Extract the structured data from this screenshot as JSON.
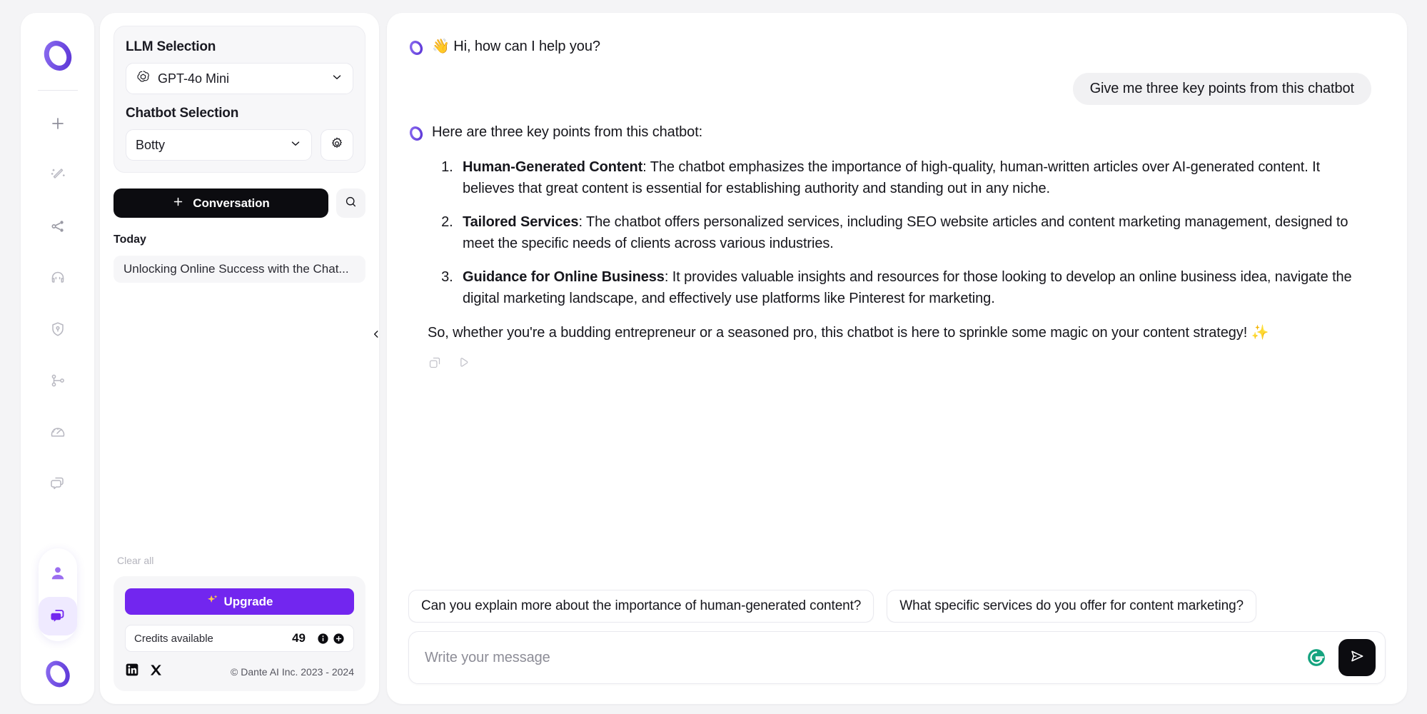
{
  "brand": {
    "accent": "#7226ef",
    "accent_light": "#8b6cf0",
    "dark": "#0c0c10",
    "logo_name": "dante-logo"
  },
  "rail": {
    "top_logo": "dante-ring-logo",
    "items": [
      {
        "name": "new-item-icon",
        "icon": "plus"
      },
      {
        "name": "magic-wand-icon",
        "icon": "wand"
      },
      {
        "name": "share-icon",
        "icon": "share"
      },
      {
        "name": "support-headset-icon",
        "icon": "headset"
      },
      {
        "name": "shield-key-icon",
        "icon": "shield"
      },
      {
        "name": "workflow-icon",
        "icon": "workflow"
      },
      {
        "name": "analytics-gauge-icon",
        "icon": "gauge"
      },
      {
        "name": "chat-bubbles-icon",
        "icon": "bubbles"
      }
    ],
    "bottom": [
      {
        "name": "account-avatar-icon",
        "icon": "user",
        "active": false
      },
      {
        "name": "chat-active-icon",
        "icon": "bubbles",
        "active": true
      }
    ],
    "bottom_logo": "dante-ring-logo"
  },
  "panel": {
    "llm": {
      "label": "LLM Selection",
      "value": "GPT-4o Mini",
      "icon": "openai-icon",
      "chevron": "chevron-down-icon"
    },
    "chatbot": {
      "label": "Chatbot Selection",
      "value": "Botty",
      "chevron": "chevron-down-icon",
      "settings_icon": "gear-icon"
    },
    "new_conversation": {
      "label": "Conversation",
      "plus_icon": "plus-icon"
    },
    "search_icon": "search-icon",
    "section_today": "Today",
    "conversations": [
      {
        "title": "Unlocking Online Success with the Chat..."
      }
    ],
    "clear_all": "Clear all",
    "upgrade": {
      "label": "Upgrade",
      "icon": "sparkle-icon"
    },
    "credits": {
      "label": "Credits available",
      "value": "49",
      "info_icon": "info-icon",
      "add_icon": "plus-circle-icon"
    },
    "social": [
      {
        "name": "linkedin-icon"
      },
      {
        "name": "x-twitter-icon"
      }
    ],
    "copyright": "© Dante AI Inc. 2023 - 2024"
  },
  "collapse": {
    "icon": "chevron-left-icon"
  },
  "chat": {
    "greeting": "👋 Hi, how can I help you?",
    "user_message": "Give me three key points from this chatbot",
    "reply_intro": "Here are three key points from this chatbot:",
    "points": [
      {
        "title": "Human-Generated Content",
        "body": ": The chatbot emphasizes the importance of high-quality, human-written articles over AI-generated content. It believes that great content is essential for establishing authority and standing out in any niche."
      },
      {
        "title": "Tailored Services",
        "body": ": The chatbot offers personalized services, including SEO website articles and content marketing management, designed to meet the specific needs of clients across various industries."
      },
      {
        "title": "Guidance for Online Business",
        "body": ": It provides valuable insights and resources for those looking to develop an online business idea, navigate the digital marketing landscape, and effectively use platforms like Pinterest for marketing."
      }
    ],
    "closing": "So, whether you're a budding entrepreneur or a seasoned pro, this chatbot is here to sprinkle some magic on your content strategy! ✨",
    "actions": [
      {
        "name": "copy-message-icon"
      },
      {
        "name": "play-audio-icon"
      }
    ],
    "suggestions": [
      "Can you explain more about the importance of human-generated content?",
      "What specific services do you offer for content marketing?"
    ],
    "input": {
      "placeholder": "Write your message",
      "grammarly_icon": "grammarly-icon",
      "send_icon": "send-icon"
    }
  }
}
